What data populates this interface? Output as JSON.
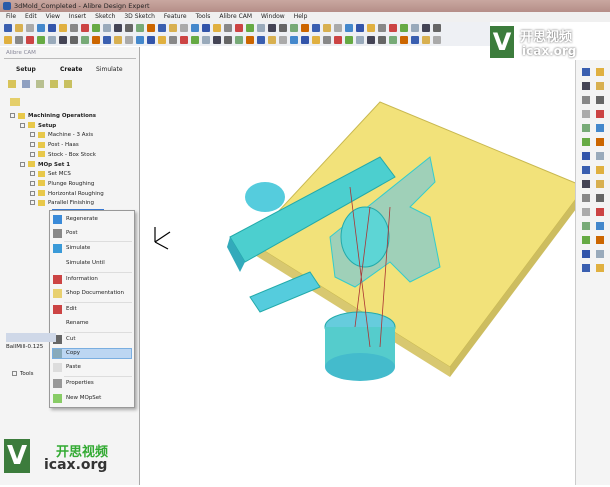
{
  "window": {
    "title": "3dMold_Completed - Alibre Design Expert"
  },
  "menu": [
    "File",
    "Edit",
    "View",
    "Insert",
    "Sketch",
    "3D Sketch",
    "Feature",
    "Tools",
    "Alibre CAM",
    "Window",
    "Help"
  ],
  "panel": {
    "title": "Alibre CAM",
    "tabs": [
      "Setup",
      "Create",
      "Simulate"
    ]
  },
  "tree": [
    {
      "label": "Machining Operations",
      "bold": true
    },
    {
      "label": "Setup",
      "bold": true
    },
    {
      "label": "Machine - 3 Axis"
    },
    {
      "label": "Post - Haas"
    },
    {
      "label": "Stock - Box Stock"
    },
    {
      "label": "MOp Set 1",
      "bold": true
    },
    {
      "label": "Set MCS"
    },
    {
      "label": "Plunge Roughing"
    },
    {
      "label": "Horizontal Roughing"
    },
    {
      "label": "Parallel Finishing"
    }
  ],
  "context_menu": [
    "Regenerate",
    "Post",
    "Simulate",
    "Simulate Until",
    "Information",
    "Shop Documentation",
    "Edit",
    "Rename",
    "Cut",
    "Copy",
    "Paste",
    "Properties",
    "New MOpSet"
  ],
  "context_selected": "Copy",
  "tools_panel": {
    "tool_label": "BallMill-0.125",
    "root": "Tools"
  },
  "watermark": {
    "cn": "开思视频",
    "url": "icax.org"
  }
}
